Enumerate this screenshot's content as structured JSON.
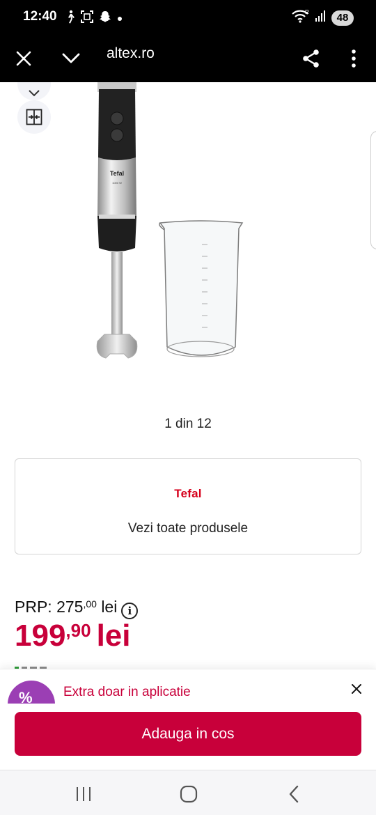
{
  "status_bar": {
    "time": "12:40",
    "battery": "48",
    "icons": [
      "walk-icon",
      "screenshot-icon",
      "snapchat-icon",
      "dot-icon",
      "wifi-icon",
      "signal-icon"
    ]
  },
  "browser": {
    "url": "altex.ro",
    "icons": [
      "close-icon",
      "chevron-down-icon",
      "share-icon",
      "more-vert-icon"
    ]
  },
  "gallery": {
    "pager_text": "1 din 12",
    "product_brand_print": "Tefal",
    "side_icons": [
      "heart-icon",
      "compare-icon"
    ]
  },
  "brand_card": {
    "logo": "Tefal",
    "link": "Vezi toate produsele"
  },
  "pricing": {
    "prp_label": "PRP:",
    "prp_int": "275",
    "prp_dec": ",00",
    "prp_currency": "lei",
    "price_int": "199",
    "price_dec": ",90",
    "price_currency": "lei"
  },
  "promo": {
    "badge": "%",
    "text": "Extra doar in aplicatie"
  },
  "cart": {
    "button": "Adauga in cos"
  },
  "colors": {
    "accent": "#c8003a",
    "promo_badge": "#9b3fb4",
    "tefal_red": "#d6001c"
  },
  "navbar": {
    "icons": [
      "recents-icon",
      "home-icon",
      "back-icon"
    ]
  }
}
